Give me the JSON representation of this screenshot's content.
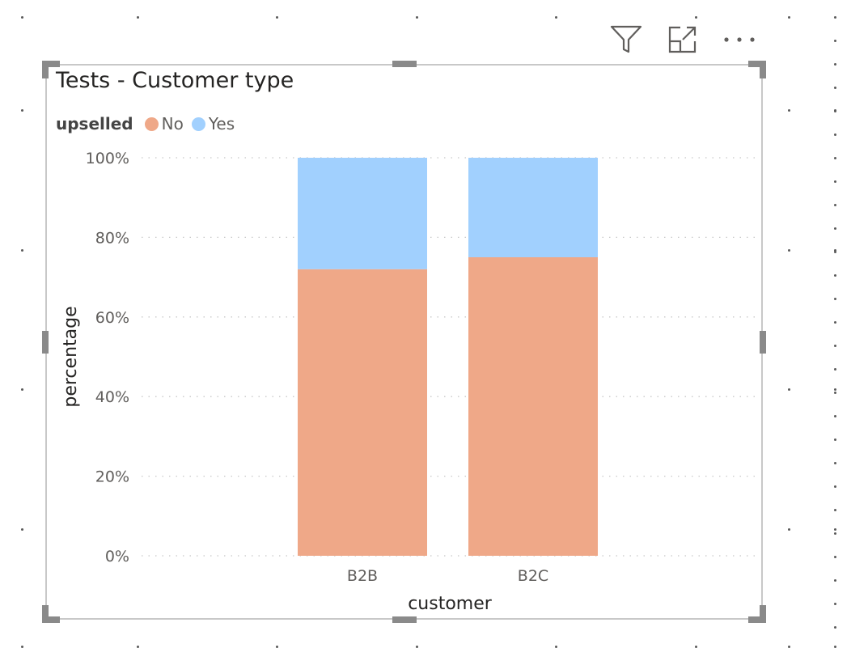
{
  "visual": {
    "title": "Tests - Customer type",
    "header_icons": [
      "filter-icon",
      "focus-mode-icon",
      "more-options-icon"
    ]
  },
  "legend": {
    "title": "upselled",
    "items": [
      {
        "label": "No",
        "color": "#EFA888"
      },
      {
        "label": "Yes",
        "color": "#A1D0FE"
      }
    ]
  },
  "chart_data": {
    "type": "bar",
    "stacked": "100%",
    "categories": [
      "B2B",
      "B2C"
    ],
    "series": [
      {
        "name": "No",
        "values": [
          72,
          75
        ]
      },
      {
        "name": "Yes",
        "values": [
          28,
          25
        ]
      }
    ],
    "xlabel": "customer",
    "ylabel": "percentage",
    "ylim": [
      0,
      100
    ],
    "yticks": [
      "0%",
      "20%",
      "40%",
      "60%",
      "80%",
      "100%"
    ],
    "grid": true,
    "legend_position": "top-left"
  }
}
